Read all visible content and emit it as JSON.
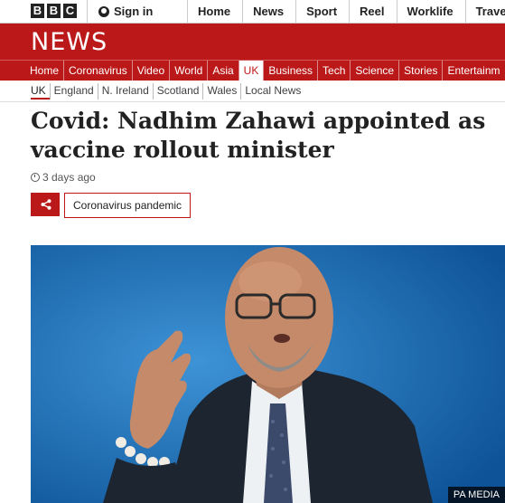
{
  "bbc_logo": [
    "B",
    "B",
    "C"
  ],
  "sign_in_label": "Sign in",
  "top_nav": [
    "Home",
    "News",
    "Sport",
    "Reel",
    "Worklife",
    "Travel"
  ],
  "news_title": "NEWS",
  "section_nav": [
    "Home",
    "Coronavirus",
    "Video",
    "World",
    "Asia",
    "UK",
    "Business",
    "Tech",
    "Science",
    "Stories",
    "Entertainm"
  ],
  "active_section": "UK",
  "sub_nav": [
    "UK",
    "England",
    "N. Ireland",
    "Scotland",
    "Wales",
    "Local News"
  ],
  "headline": "Covid: Nadhim Zahawi appointed as vaccine rollout minister",
  "timestamp": "3 days ago",
  "share_icon": "share-icon",
  "topic_tag": "Coronavirus pandemic",
  "image_credit": "PA MEDIA",
  "colors": {
    "brand_red": "#bb1919",
    "text": "#222222",
    "image_bg": "#1a6db8"
  }
}
